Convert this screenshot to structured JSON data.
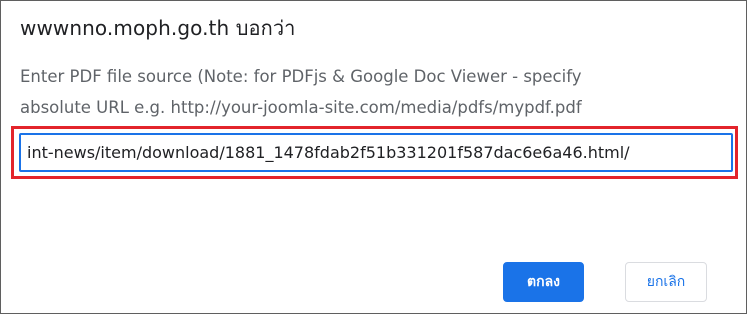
{
  "dialog": {
    "title": "wwwnno.moph.go.th บอกว่า",
    "message_lines": [
      "Enter PDF file source (Note: for PDFjs & Google Doc Viewer - specify",
      "absolute URL e.g. http://your-joomla-site.com/media/pdfs/mypdf.pdf"
    ],
    "input_value": "/int-news/item/download/1881_1478fdab2f51b331201f587dac6e6a46.html",
    "ok_label": "ตกลง",
    "cancel_label": "ยกเลิก"
  },
  "colors": {
    "accent": "#1a73e8",
    "highlight_border": "#e3242b",
    "dialog_border": "#5f5f5f"
  }
}
